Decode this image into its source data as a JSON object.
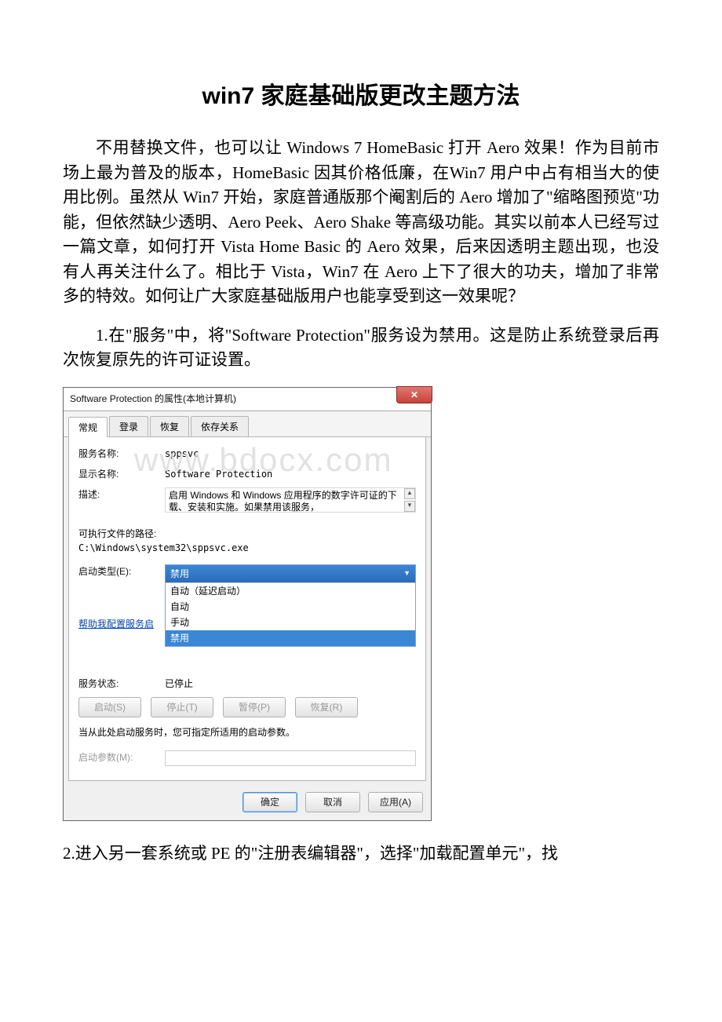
{
  "title": "win7 家庭基础版更改主题方法",
  "intro": "不用替换文件，也可以让 Windows 7 HomeBasic 打开 Aero 效果！作为目前市场上最为普及的版本，HomeBasic 因其价格低廉，在Win7 用户中占有相当大的使用比例。虽然从 Win7 开始，家庭普通版那个阉割后的 Aero 增加了\"缩略图预览\"功能，但依然缺少透明、Aero Peek、Aero Shake 等高级功能。其实以前本人已经写过一篇文章，如何打开 Vista Home Basic 的 Aero 效果，后来因透明主题出现，也没有人再关注什么了。相比于 Vista，Win7 在 Aero 上下了很大的功夫，增加了非常多的特效。如何让广大家庭基础版用户也能享受到这一效果呢？",
  "step1": "1.在\"服务\"中，将\"Software Protection\"服务设为禁用。这是防止系统登录后再次恢复原先的许可证设置。",
  "step2": "2.进入另一套系统或 PE 的\"注册表编辑器\"，选择\"加载配置单元\"，找",
  "dialog": {
    "title": "Software Protection 的属性(本地计算机)",
    "close": "✕",
    "tabs": {
      "general": "常规",
      "logon": "登录",
      "recovery": "恢复",
      "deps": "依存关系"
    },
    "labels": {
      "serviceName": "服务名称:",
      "displayName": "显示名称:",
      "desc": "描述:",
      "exePath": "可执行文件的路径:",
      "startupType": "启动类型(E):",
      "helpLink": "帮助我配置服务启",
      "status": "服务状态:",
      "hint": "当从此处启动服务时，您可指定所适用的启动参数。",
      "startParams": "启动参数(M):"
    },
    "values": {
      "serviceName": "sppsvc",
      "displayName": "Software Protection",
      "desc": "启用 Windows 和 Windows 应用程序的数字许可证的下载、安装和实施。如果禁用该服务，",
      "exePath": "C:\\Windows\\system32\\sppsvc.exe",
      "startupSelected": "禁用",
      "options": {
        "autoDelay": "自动（延迟启动）",
        "auto": "自动",
        "manual": "手动",
        "disabled": "禁用"
      },
      "status": "已停止"
    },
    "buttons": {
      "start": "启动(S)",
      "stop": "停止(T)",
      "pause": "暂停(P)",
      "resume": "恢复(R)",
      "ok": "确定",
      "cancel": "取消",
      "apply": "应用(A)"
    },
    "watermark": "www.bdocx.com"
  }
}
